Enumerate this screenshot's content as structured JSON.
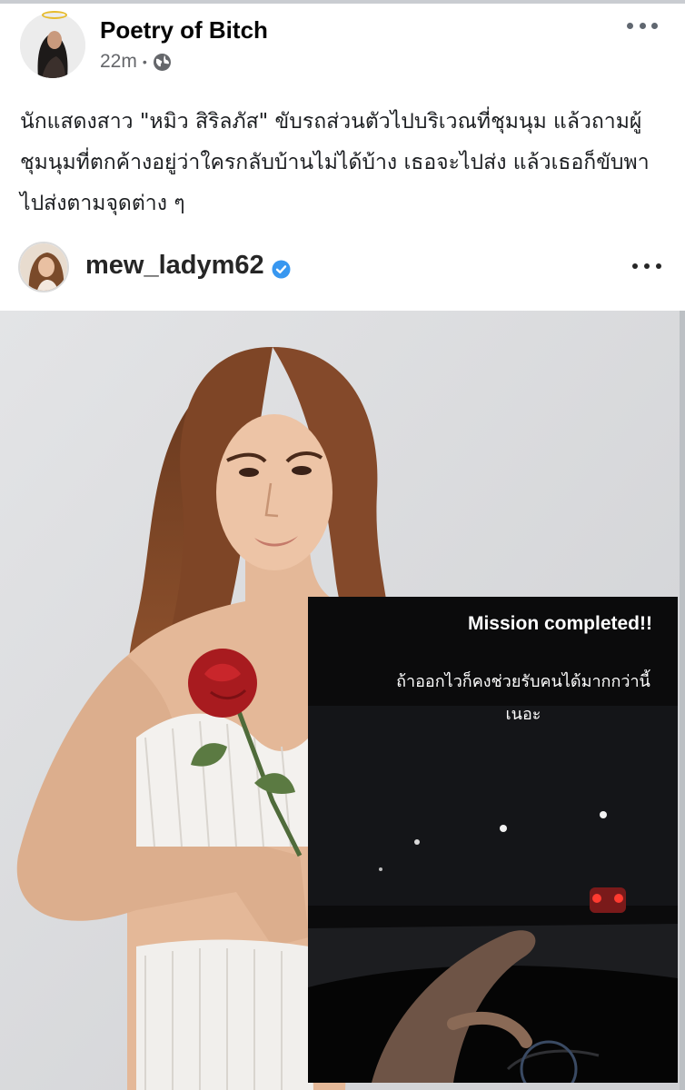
{
  "post": {
    "author": "Poetry of Bitch",
    "time": "22m",
    "separator": "•",
    "privacy_icon": "globe-icon",
    "more_icon": "more-options-icon",
    "text": "นักแสดงสาว \"หมิว สิริลภัส\" ขับรถส่วนตัวไปบริเวณที่ชุมนุม แล้วถามผู้ชุมนุมที่ตกค้างอยู่ว่าใครกลับบ้านไม่ได้บ้าง เธอจะไปส่ง แล้วเธอก็ขับพาไปส่งตามจุดต่าง ๆ"
  },
  "embed": {
    "username": "mew_ladym62",
    "verified_icon": "verified-badge-icon",
    "more_icon": "more-options-icon",
    "story": {
      "title": "Mission completed!!",
      "caption": "ถ้าออกไวก็คงช่วยรับคนได้มากกว่านี้เนอะ"
    }
  },
  "colors": {
    "secondary_text": "#65676b",
    "verified_blue": "#3897f0",
    "halo_gold": "#e6bb2c"
  }
}
